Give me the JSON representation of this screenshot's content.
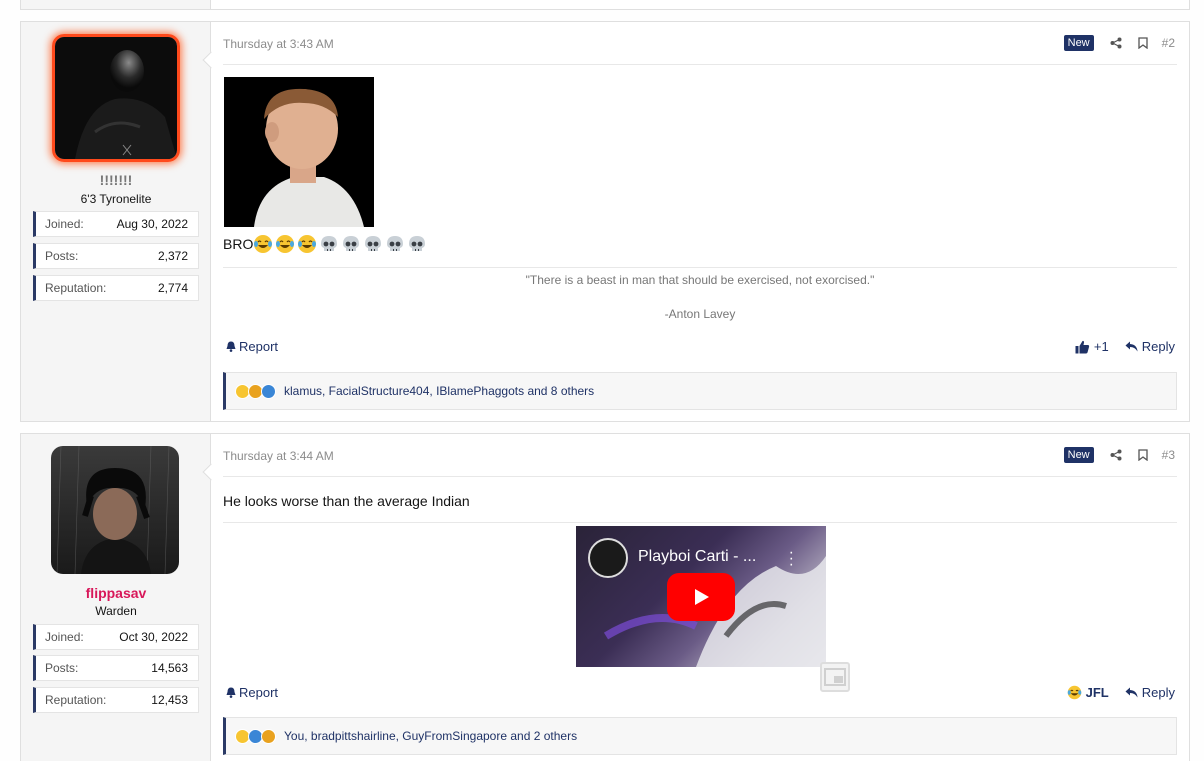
{
  "posts": [
    {
      "username": "!!!!!!!",
      "user_title": "6'3 Tyronelite",
      "stats": [
        {
          "label": "Joined:",
          "value": "Aug 30, 2022"
        },
        {
          "label": "Posts:",
          "value": "2,372"
        },
        {
          "label": "Reputation:",
          "value": "2,774"
        }
      ],
      "date": "Thursday at 3:43 AM",
      "badge": "New",
      "post_number": "#2",
      "text": "BRO",
      "signature_quote": "\"There is a beast in man that should be exercised, not exorcised.\"",
      "signature_author": "-Anton Lavey",
      "report_label": "Report",
      "reaction_label": "+1",
      "reply_label": "Reply",
      "reactions_text": "klamus, FacialStructure404, IBlamePhaggots and 8 others"
    },
    {
      "username": "flippasav",
      "user_title": "Warden",
      "stats": [
        {
          "label": "Joined:",
          "value": "Oct 30, 2022"
        },
        {
          "label": "Posts:",
          "value": "14,563"
        },
        {
          "label": "Reputation:",
          "value": "12,453"
        }
      ],
      "date": "Thursday at 3:44 AM",
      "badge": "New",
      "post_number": "#3",
      "text": "He looks worse than the average Indian",
      "video_title": "Playboi Carti - ...",
      "report_label": "Report",
      "reaction_label": "JFL",
      "reply_label": "Reply",
      "reactions_text": "You, bradpittshairline, GuyFromSingapore and 2 others"
    }
  ],
  "colors": {
    "accent": "#1f3266",
    "username_pink": "#d8185a",
    "avatar_glow": "#ff4a1c"
  },
  "icons": [
    "share-icon",
    "bookmark-icon",
    "bell-icon",
    "thumbs-up-icon",
    "reply-icon",
    "skull-emoji",
    "crying-laughing-emoji",
    "play-icon"
  ]
}
